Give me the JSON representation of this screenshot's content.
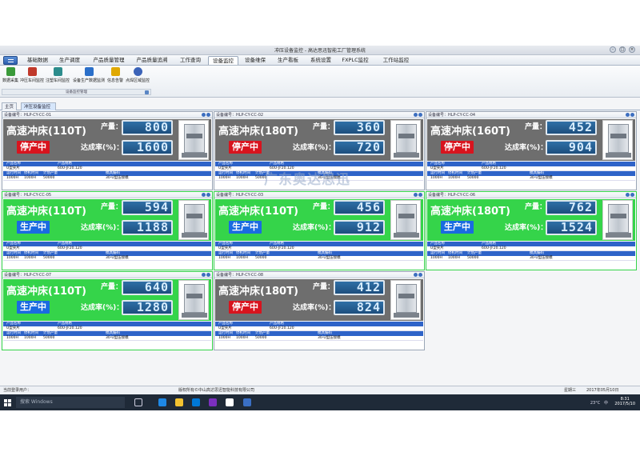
{
  "window": {
    "title": "冲压设备监控 - 高达思迅智能工厂管理系统",
    "controls": [
      "-",
      "□",
      "×"
    ]
  },
  "menu": {
    "tabs": [
      "基础数据",
      "生产调度",
      "产品质量管理",
      "产品质量追溯",
      "工作查询",
      "设备监控",
      "设备维保",
      "生产看板",
      "系统设置",
      "FXPLC监控",
      "工作站监控"
    ]
  },
  "ribbon": {
    "buttons": [
      "数据采集",
      "冲压车间监控",
      "注塑车间监控",
      "设备生产数据监测",
      "信息告警",
      "点焊区域监控"
    ],
    "group_label": "设备监控管理"
  },
  "doc_tabs": [
    "主页",
    "冲压设备监控",
    "×"
  ],
  "machines": [
    {
      "id": "设备编号：HLP-CY-CC-01",
      "model": "高速冲床(110T)",
      "status": "停产中",
      "running": false,
      "output_label": "产量：",
      "output": "800",
      "rate_label": "达成率(%)：",
      "rate": "1600",
      "product_header": [
        "产品名称",
        "产品规格"
      ],
      "product": [
        "U型夹片",
        "60U-JF20.120"
      ],
      "info_header": [
        "运行时间",
        "停机时间",
        "计划产量",
        "模具编码"
      ],
      "info": [
        "1000H",
        "1000H",
        "50000",
        "30-U型压接模"
      ]
    },
    {
      "id": "设备编号：HLP-CY-CC-02",
      "model": "高速冲床(180T)",
      "status": "停产中",
      "running": false,
      "output_label": "产量：",
      "output": "360",
      "rate_label": "达成率(%)：",
      "rate": "720",
      "product_header": [
        "产品名称",
        "产品规格"
      ],
      "product": [
        "U型夹片",
        "60U-JF20.120"
      ],
      "info_header": [
        "运行时间",
        "停机时间",
        "计划产量",
        "模具编码"
      ],
      "info": [
        "1000H",
        "1000H",
        "50000",
        "30-U型压接模"
      ]
    },
    {
      "id": "设备编号：HLP-CY-CC-04",
      "model": "高速冲床(160T)",
      "status": "停产中",
      "running": false,
      "output_label": "产量：",
      "output": "452",
      "rate_label": "达成率(%)：",
      "rate": "904",
      "product_header": [
        "产品名称",
        "产品规格"
      ],
      "product": [
        "U型夹片",
        "60U-JF20.120"
      ],
      "info_header": [
        "运行时间",
        "停机时间",
        "计划产量",
        "模具编码"
      ],
      "info": [
        "1000H",
        "1000H",
        "50000",
        "30-U型压接模"
      ]
    },
    {
      "id": "设备编号：HLP-CY-CC-05",
      "model": "高速冲床(110T)",
      "status": "生产中",
      "running": true,
      "output_label": "产量：",
      "output": "594",
      "rate_label": "达成率(%)：",
      "rate": "1188",
      "product_header": [
        "产品名称",
        "产品规格"
      ],
      "product": [
        "U型夹片",
        "60U-JF20.120"
      ],
      "info_header": [
        "运行时间",
        "停机时间",
        "计划产量",
        "模具编码"
      ],
      "info": [
        "1000H",
        "1000H",
        "50000",
        "30-U型压接模"
      ]
    },
    {
      "id": "设备编号：HLP-CY-CC-03",
      "model": "高速冲床(110T)",
      "status": "生产中",
      "running": true,
      "output_label": "产量：",
      "output": "456",
      "rate_label": "达成率(%)：",
      "rate": "912",
      "product_header": [
        "产品名称",
        "产品规格"
      ],
      "product": [
        "U型夹片",
        "60U-JF20.120"
      ],
      "info_header": [
        "运行时间",
        "停机时间",
        "计划产量",
        "模具编码"
      ],
      "info": [
        "1000H",
        "1000H",
        "50000",
        "30-U型压接模"
      ]
    },
    {
      "id": "设备编号：HLP-CY-CC-06",
      "model": "高速冲床(180T)",
      "status": "生产中",
      "running": true,
      "output_label": "产量：",
      "output": "762",
      "rate_label": "达成率(%)：",
      "rate": "1524",
      "product_header": [
        "产品名称",
        "产品规格"
      ],
      "product": [
        "U型夹片",
        "60U-JF20.120"
      ],
      "info_header": [
        "运行时间",
        "停机时间",
        "计划产量",
        "模具编码"
      ],
      "info": [
        "1000H",
        "1000H",
        "50000",
        "30-U型压接模"
      ]
    },
    {
      "id": "设备编号：HLP-CY-CC-07",
      "model": "高速冲床(110T)",
      "status": "生产中",
      "running": true,
      "output_label": "产量：",
      "output": "640",
      "rate_label": "达成率(%)：",
      "rate": "1280",
      "product_header": [
        "产品名称",
        "产品规格"
      ],
      "product": [
        "U型夹片",
        "60U-JF20.120"
      ],
      "info_header": [
        "运行时间",
        "停机时间",
        "计划产量",
        "模具编码"
      ],
      "info": [
        "1000H",
        "1000H",
        "50000",
        "30-U型压接模"
      ]
    },
    {
      "id": "设备编号：HLP-CY-CC-08",
      "model": "高速冲床(180T)",
      "status": "停产中",
      "running": false,
      "output_label": "产量：",
      "output": "412",
      "rate_label": "达成率(%)：",
      "rate": "824",
      "product_header": [
        "产品名称",
        "产品规格"
      ],
      "product": [
        "U型夹片",
        "60U-JF20.120"
      ],
      "info_header": [
        "运行时间",
        "停机时间",
        "计划产量",
        "模具编码"
      ],
      "info": [
        "1000H",
        "1000H",
        "50000",
        "30-U型压接模"
      ]
    }
  ],
  "colors": {
    "stopped_panel": "#6e6e6e",
    "running_panel": "#35d44a",
    "stopped_badge": "#d8141e",
    "running_badge": "#1a6be0",
    "table_header": "#2e63c8"
  },
  "watermark": "广东奥达思迅",
  "status": {
    "user_label": "当前登录用户：",
    "copyright": "版权所有©中山高达思迅智能科技有限公司",
    "weekday": "星期三",
    "date": "2017年05月10日"
  },
  "taskbar": {
    "search_placeholder": "搜索 Windows",
    "temperature": "23°C",
    "ime": "中",
    "time": "8:31",
    "date": "2017/5/10"
  }
}
